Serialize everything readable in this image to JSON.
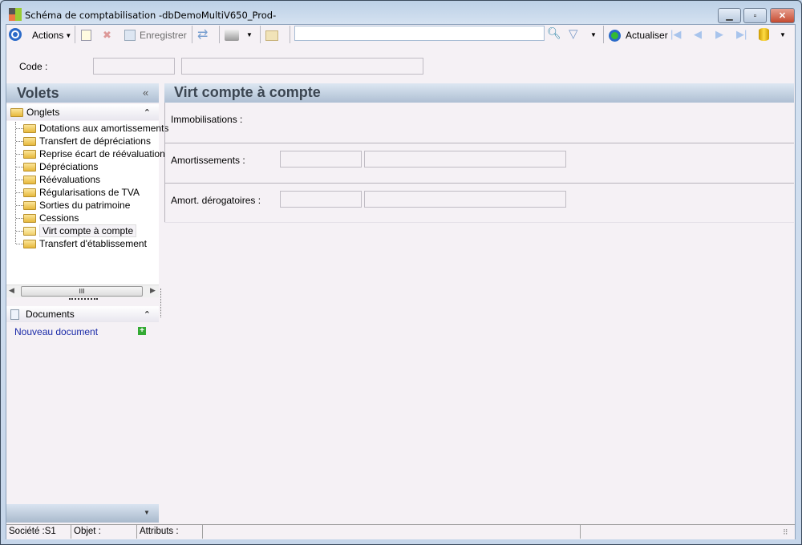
{
  "window": {
    "title": "Schéma de comptabilisation -dbDemoMultiV650_Prod-"
  },
  "toolbar": {
    "actions_label": "Actions",
    "save_label": "Enregistrer",
    "search_value": "",
    "refresh_label": "Actualiser"
  },
  "code": {
    "label": "Code :",
    "value": "",
    "description": ""
  },
  "sidebar": {
    "title": "Volets",
    "tabs_header": "Onglets",
    "items": [
      {
        "label": "Dotations aux amortissements"
      },
      {
        "label": "Transfert de dépréciations"
      },
      {
        "label": "Reprise écart de réévaluation"
      },
      {
        "label": "Dépréciations"
      },
      {
        "label": "Réévaluations"
      },
      {
        "label": "Régularisations de TVA"
      },
      {
        "label": "Sorties du patrimoine"
      },
      {
        "label": "Cessions"
      },
      {
        "label": "Virt compte à compte",
        "selected": true
      },
      {
        "label": "Transfert d'établissement"
      }
    ],
    "documents_header": "Documents",
    "new_document": "Nouveau document",
    "scroll_grip": "III"
  },
  "main": {
    "title": "Virt compte à compte",
    "fields": [
      {
        "label": "Immobilisations :"
      },
      {
        "label": "Amortissements :",
        "code": "",
        "description": ""
      },
      {
        "label": "Amort. dérogatoires :",
        "code": "",
        "description": ""
      }
    ]
  },
  "status": {
    "societe": "Société :S1",
    "objet": "Objet :",
    "attributs": "Attributs :"
  }
}
